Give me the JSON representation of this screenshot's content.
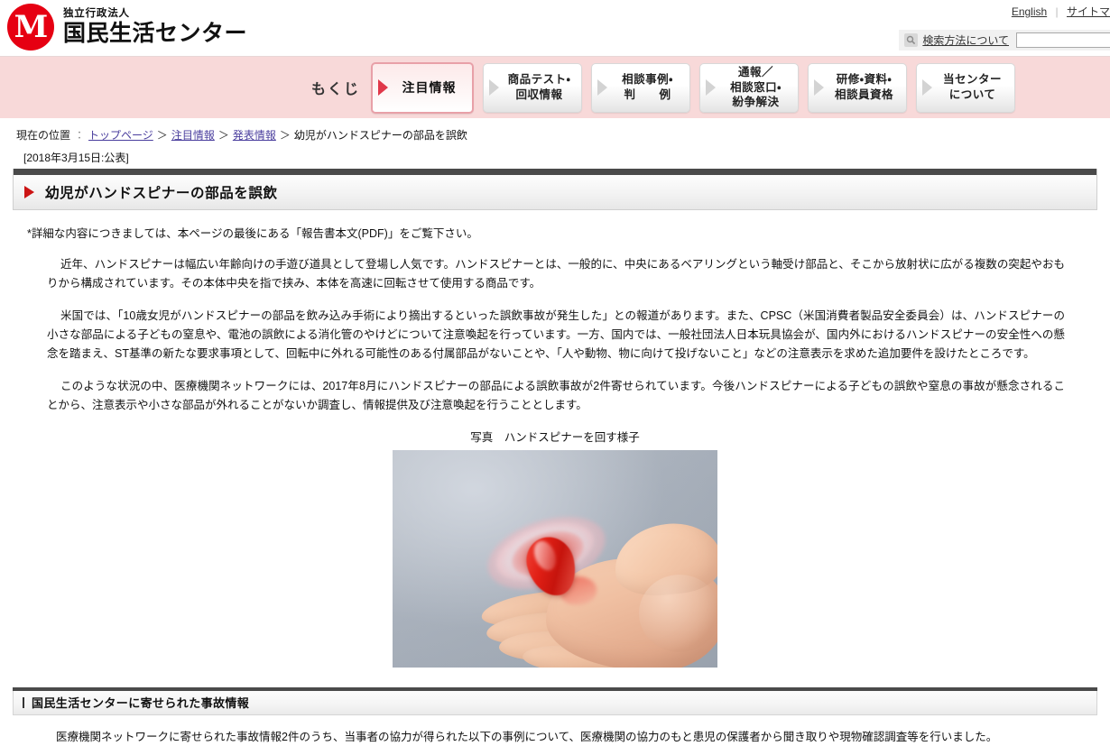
{
  "header": {
    "logo_glyph": "M",
    "logo_subtitle": "独立行政法人",
    "logo_title": "国民生活センター",
    "top_links": [
      {
        "label": "English"
      },
      {
        "label": "サイトマ"
      }
    ],
    "link_divider": "|",
    "search_help_label": "検索方法について",
    "search_placeholder": "",
    "search_value": "",
    "icon_search_help": "magnifier-icon"
  },
  "nav": {
    "menu_label": "もくじ",
    "items": [
      {
        "label": "注目情報",
        "active": true
      },
      {
        "label": "商品テスト・\n回収情報",
        "active": false
      },
      {
        "label": "相談事例・\n判　　例",
        "active": false
      },
      {
        "label": "通報／\n相談窓口・\n紛争解決",
        "active": false
      },
      {
        "label": "研修・資料・\n相談員資格",
        "active": false
      },
      {
        "label": "当センター\nについて",
        "active": false
      }
    ]
  },
  "breadcrumb": {
    "label": "現在の位置",
    "colon": "：",
    "separator": "＞",
    "items": [
      {
        "label": "トップページ",
        "link": true
      },
      {
        "label": "注目情報",
        "link": true
      },
      {
        "label": "発表情報",
        "link": true
      },
      {
        "label": "幼児がハンドスピナーの部品を誤飲",
        "link": false
      }
    ]
  },
  "publication_date": "[2018年3月15日:公表]",
  "page_title": "幼児がハンドスピナーの部品を誤飲",
  "content": {
    "note": "*詳細な内容につきましては、本ページの最後にある「報告書本文(PDF)」をご覧下さい。",
    "paragraphs": [
      "近年、ハンドスピナーは幅広い年齢向けの手遊び道具として登場し人気です。ハンドスピナーとは、一般的に、中央にあるベアリングという軸受け部品と、そこから放射状に広がる複数の突起やおもりから構成されています。その本体中央を指で挟み、本体を高速に回転させて使用する商品です。",
      "米国では、「10歳女児がハンドスピナーの部品を飲み込み手術により摘出するといった誤飲事故が発生した」との報道があります。また、CPSC（米国消費者製品安全委員会）は、ハンドスピナーの小さな部品による子どもの窒息や、電池の誤飲による消化管のやけどについて注意喚起を行っています。一方、国内では、一般社団法人日本玩具協会が、国内外におけるハンドスピナーの安全性への懸念を踏まえ、ST基準の新たな要求事項として、回転中に外れる可能性のある付属部品がないことや、「人や動物、物に向けて投げないこと」などの注意表示を求めた追加要件を設けたところです。",
      "このような状況の中、医療機関ネットワークには、2017年8月にハンドスピナーの部品による誤飲事故が2件寄せられています。今後ハンドスピナーによる子どもの誤飲や窒息の事故が懸念されることから、注意表示や小さな部品が外れることがないか調査し、情報提供及び注意喚起を行うこととします。"
    ]
  },
  "photo": {
    "caption": "写真　ハンドスピナーを回す様子",
    "alt_name": "hand-spinner-photo"
  },
  "section": {
    "title": "国民生活センターに寄せられた事故情報",
    "paragraph": "医療機関ネットワークに寄せられた事故情報2件のうち、当事者の協力が得られた以下の事例について、医療機関の協力のもと患児の保護者から聞き取りや現物確認調査等を行いました。"
  },
  "colors": {
    "brand_red": "#e60012",
    "nav_bg": "#f8d9d9",
    "active_border": "#e8a0a8",
    "title_bar_top": "#4a4a4a",
    "link": "#4b3f9e"
  }
}
